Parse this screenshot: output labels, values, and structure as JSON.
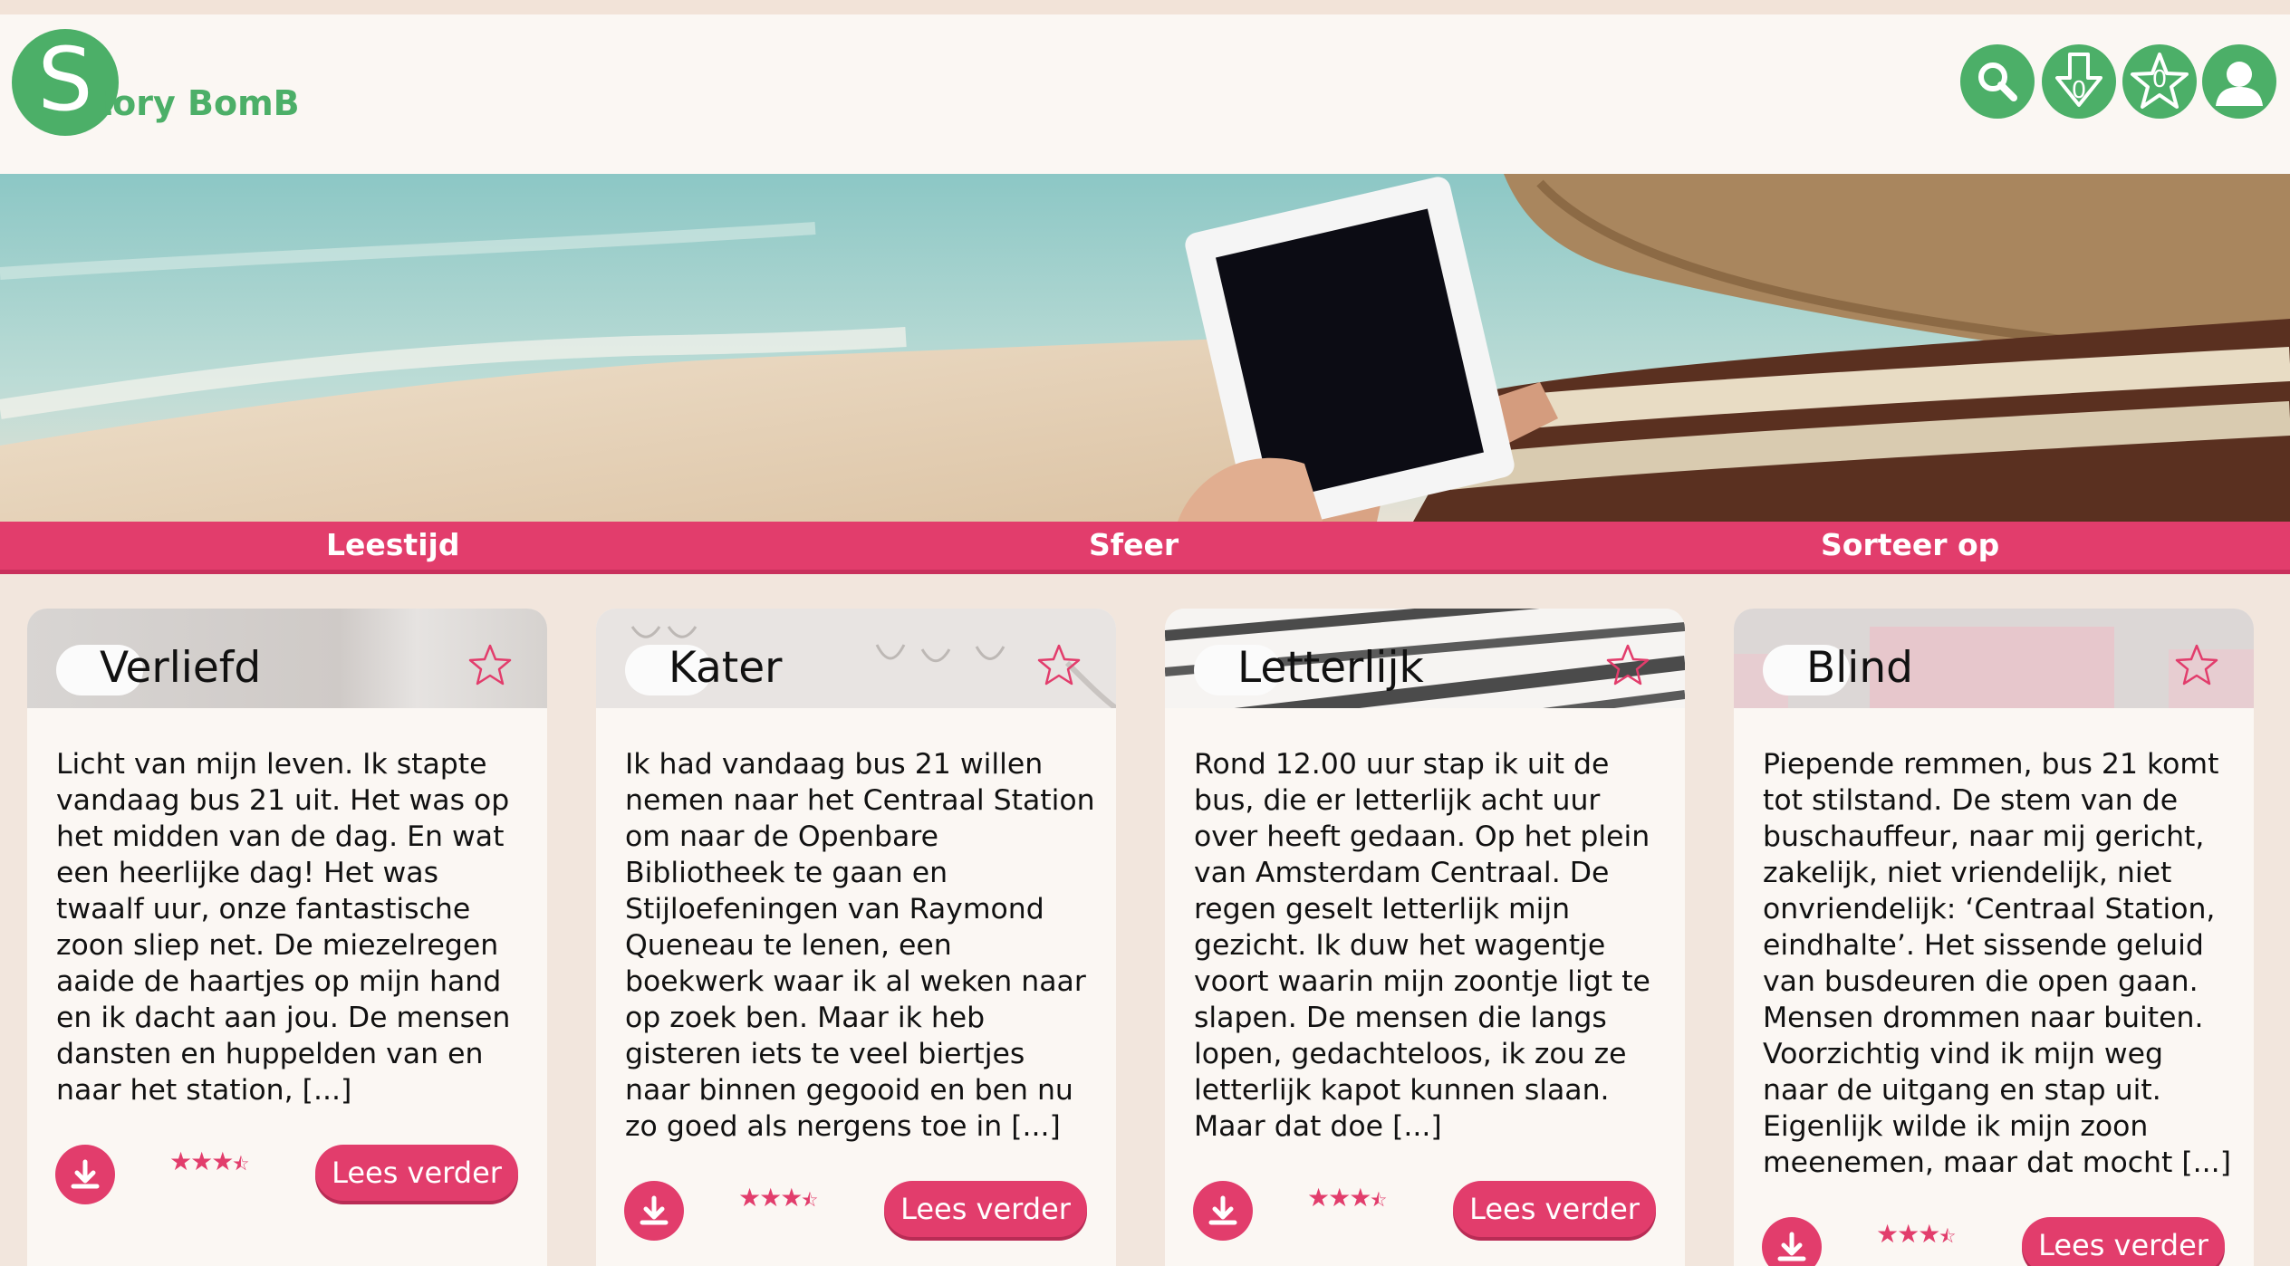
{
  "brand": {
    "letter": "S",
    "name": "tory BomB"
  },
  "header_icons": [
    {
      "name": "search-icon"
    },
    {
      "name": "download-icon",
      "count": "0"
    },
    {
      "name": "star-icon",
      "count": "0"
    },
    {
      "name": "user-icon"
    }
  ],
  "filters": {
    "reading_time": "Leestijd",
    "mood": "Sfeer",
    "sort": "Sorteer op"
  },
  "colors": {
    "brand_green": "#4caf68",
    "accent_pink": "#e23d6c",
    "page_bg": "#f2e6dd"
  },
  "cards": [
    {
      "title": "Verliefd",
      "excerpt": "Licht van mijn leven. Ik stapte vandaag bus 21 uit. Het was op het midden van de dag. En wat een heerlijke dag! Het was twaalf uur, onze fantastische zoon sliep net. De miezelregen aaide de haartjes op mijn hand en ik dacht aan jou. De mensen dansten en huppelden van en naar het station, [...]",
      "rating": 3.5,
      "read_more": "Lees verder"
    },
    {
      "title": "Kater",
      "excerpt": "Ik had vandaag bus 21 willen nemen naar het Centraal Station om naar de Openbare Bibliotheek te gaan en Stijloefeningen van Raymond Queneau te lenen, een boekwerk waar ik al weken naar op zoek ben. Maar ik heb gisteren iets te veel biertjes naar binnen gegooid en ben nu zo goed als nergens toe in [...]",
      "rating": 3.5,
      "read_more": "Lees verder"
    },
    {
      "title": "Letterlijk",
      "excerpt": "Rond 12.00 uur stap ik uit de bus, die er letterlijk acht uur over heeft gedaan. Op het plein van Amsterdam Centraal. De regen geselt letterlijk mijn gezicht. Ik duw het wagentje voort waarin mijn zoontje ligt te slapen. De mensen die langs lopen, gedachteloos, ik zou ze letterlijk kapot kunnen slaan. Maar dat doe [...]",
      "rating": 3.5,
      "read_more": "Lees verder"
    },
    {
      "title": "Blind",
      "excerpt": "Piepende remmen, bus 21 komt tot stilstand. De stem van de buschauffeur, naar mij gericht, zakelijk, niet vriendelijk, niet onvriendelijk: ‘Centraal Station, eindhalte’. Het sissende geluid van busdeuren die open gaan. Mensen drommen naar buiten. Voorzichtig vind ik mijn weg naar de uitgang en stap uit. Eigenlijk wilde ik mijn zoon meenemen, maar dat mocht [...]",
      "rating": 3.5,
      "read_more": "Lees verder"
    }
  ]
}
